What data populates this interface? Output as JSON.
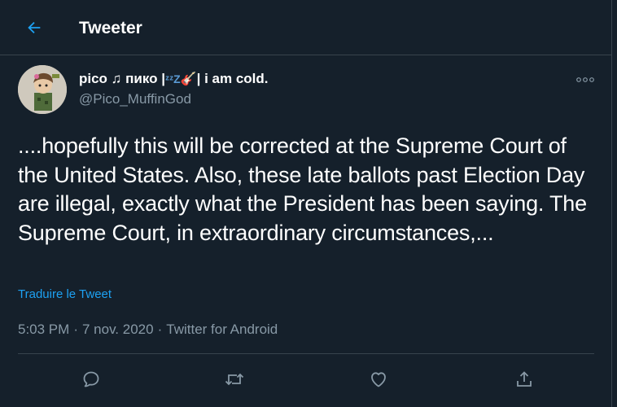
{
  "header": {
    "title": "Tweeter",
    "back_icon": "back-arrow-icon"
  },
  "tweet": {
    "display_name": "pico ♫ пико |",
    "display_name_suffix": "| i am cold.",
    "username": "@Pico_MuffinGod",
    "text": "....hopefully this will be corrected at the Supreme Court of the United States. Also, these late ballots past Election Day are illegal, exactly what the President has been saying. The Supreme Court, in extraordinary circumstances,...",
    "translate_label": "Traduire le Tweet",
    "time": "5:03 PM",
    "date": "7 nov. 2020",
    "source": "Twitter for Android",
    "separator": "·"
  },
  "actions": [
    {
      "name": "reply-button",
      "icon": "reply-icon"
    },
    {
      "name": "retweet-button",
      "icon": "retweet-icon"
    },
    {
      "name": "like-button",
      "icon": "heart-icon"
    },
    {
      "name": "share-button",
      "icon": "share-icon"
    }
  ],
  "colors": {
    "background": "#15202b",
    "border": "#38444d",
    "secondary_text": "#8899a6",
    "accent": "#1da1f2"
  }
}
